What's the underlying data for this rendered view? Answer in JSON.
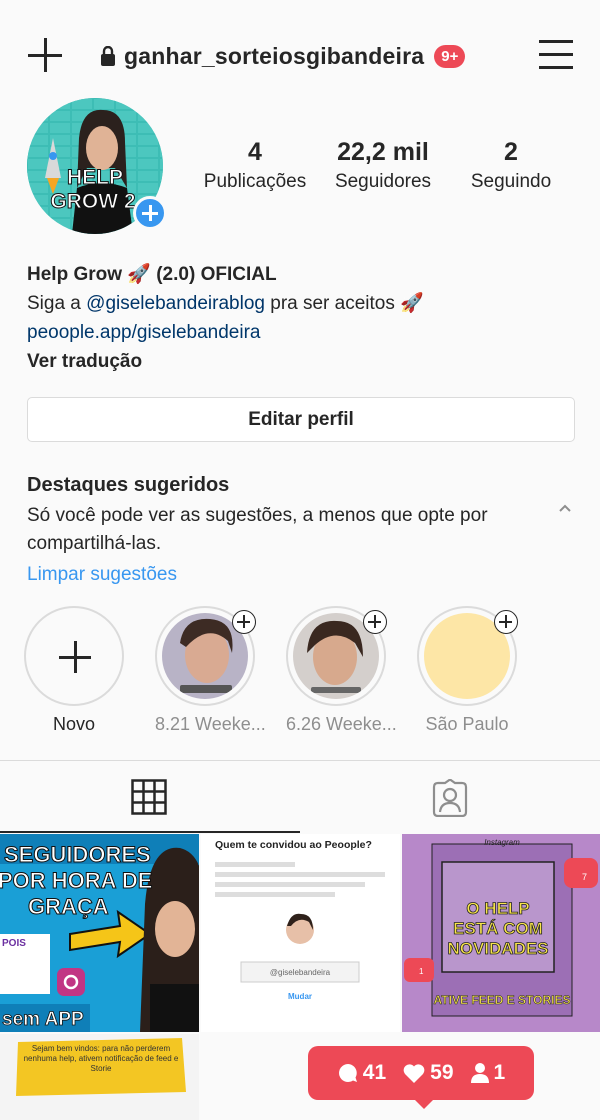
{
  "header": {
    "username": "ganhar_sorteiosgibandeira",
    "badge": "9+",
    "icons": {
      "new": "plus-icon",
      "lock": "lock-icon",
      "menu": "hamburger-menu-icon"
    }
  },
  "profile": {
    "avatar_text": "HELP GROW 2",
    "stats": [
      {
        "value": "4",
        "label": "Publicações"
      },
      {
        "value": "22,2 mil",
        "label": "Seguidores"
      },
      {
        "value": "2",
        "label": "Seguindo"
      }
    ],
    "bio": {
      "name": "Help Grow 🚀 (2.0) OFICIAL",
      "line2_pre": "Siga a ",
      "line2_mention": "@giselebandeirablog",
      "line2_post": "  pra ser aceitos 🚀",
      "link": "peoople.app/giselebandeira",
      "translate": "Ver tradução"
    },
    "edit_button": "Editar perfil"
  },
  "suggestions": {
    "title": "Destaques sugeridos",
    "text": "Só você pode ver as sugestões, a menos que opte por compartilhá-las.",
    "clear": "Limpar sugestões"
  },
  "highlights": [
    {
      "label": "Novo"
    },
    {
      "label": "8.21 Weeke..."
    },
    {
      "label": "6.26 Weeke..."
    },
    {
      "label": "São Paulo"
    }
  ],
  "tabs": {
    "grid": "grid-icon",
    "tagged": "tagged-icon"
  },
  "posts": [
    {
      "text_lines": [
        "SEGUIDORES",
        "POR HORA DE",
        "GRAÇA"
      ],
      "bottom": "sem APP"
    },
    {
      "title": "Quem te convidou ao Peoople?",
      "input": "@giselebandeira",
      "button": "Mudar"
    },
    {
      "brand": "Instagram",
      "headline_lines": [
        "O HELP",
        "ESTÁ COM",
        "NOVIDADES"
      ],
      "footer": "ATIVE FEED E STORIES",
      "badge": "7",
      "badge2": "1"
    },
    {
      "text": "Sejam bem vindos: para não perderem nenhuma help, ativem notificação de feed e Storie"
    }
  ],
  "notification": {
    "comments": "41",
    "likes": "59",
    "follows": "1"
  },
  "colors": {
    "accent": "#3897f0",
    "badge": "#ed4956",
    "text": "#262626",
    "muted": "#8e8e8e"
  }
}
